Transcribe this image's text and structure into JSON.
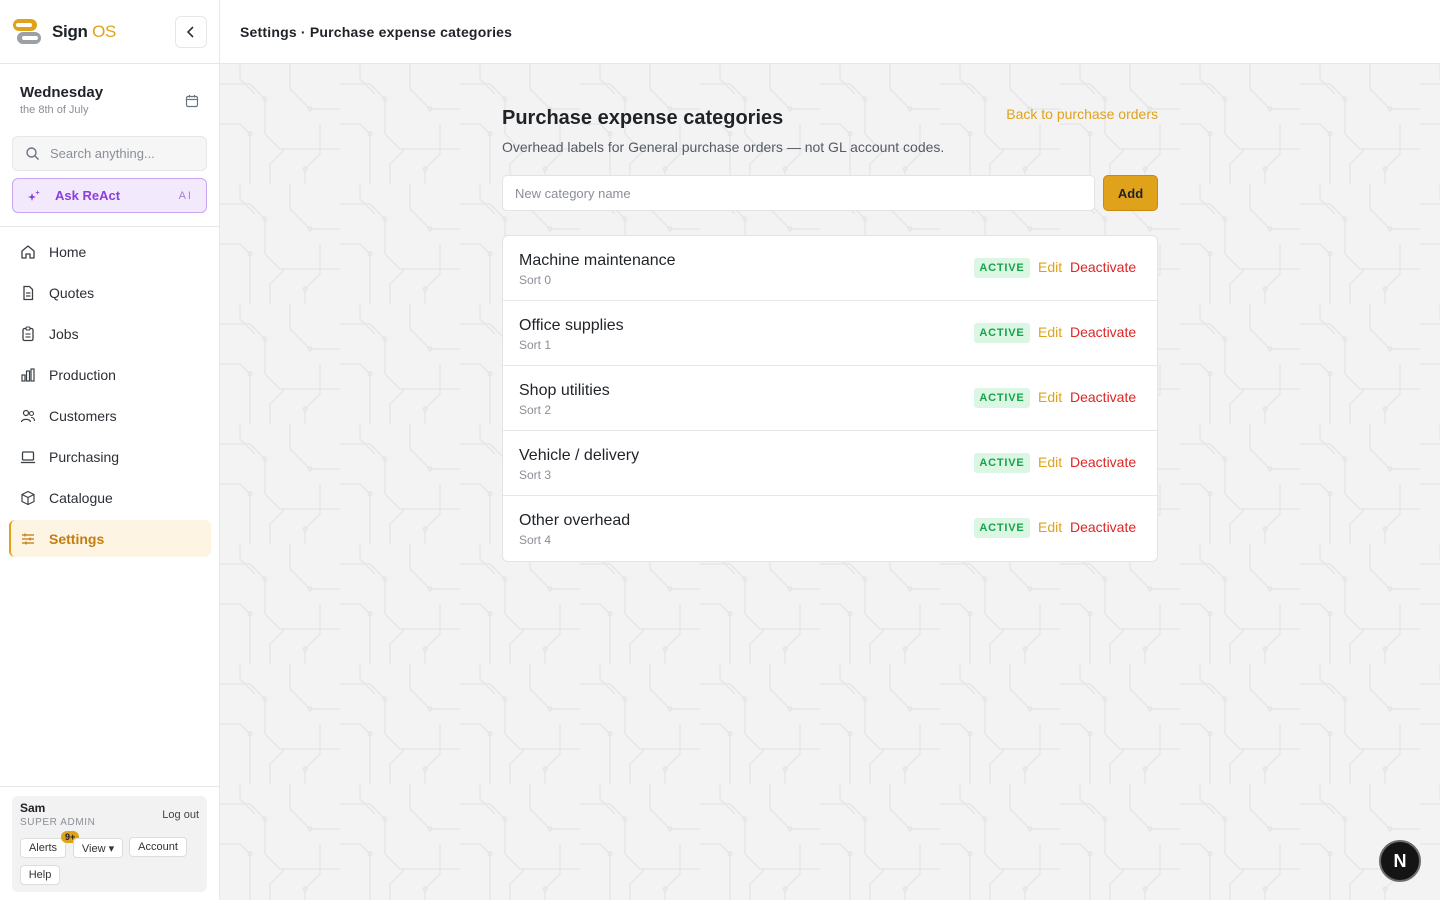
{
  "brand": {
    "name": "Sign ",
    "suffix": "OS"
  },
  "date": {
    "day": "Wednesday",
    "sub": "the 8th of July"
  },
  "search": {
    "placeholder": "Search anything..."
  },
  "ask": {
    "label": "Ask ReAct",
    "tag": "AI"
  },
  "nav": {
    "items": [
      {
        "label": "Home",
        "icon": "home-icon"
      },
      {
        "label": "Quotes",
        "icon": "document-icon"
      },
      {
        "label": "Jobs",
        "icon": "clipboard-icon"
      },
      {
        "label": "Production",
        "icon": "bar-chart-icon"
      },
      {
        "label": "Customers",
        "icon": "users-icon"
      },
      {
        "label": "Purchasing",
        "icon": "laptop-icon"
      },
      {
        "label": "Catalogue",
        "icon": "box-icon"
      },
      {
        "label": "Settings",
        "icon": "sliders-icon",
        "active": true
      }
    ]
  },
  "user": {
    "name": "Sam",
    "role": "SUPER ADMIN",
    "logout": "Log out",
    "alerts": "Alerts",
    "alerts_badge": "9+",
    "view": "View ▾",
    "account": "Account",
    "help": "Help"
  },
  "topbar": {
    "breadcrumb": "Settings · Purchase expense categories"
  },
  "page": {
    "title": "Purchase expense categories",
    "subtitle": "Overhead labels for General purchase orders — not GL account codes.",
    "back_link": "Back to purchase orders",
    "new_placeholder": "New category name",
    "add_label": "Add"
  },
  "categories": [
    {
      "name": "Machine maintenance",
      "sort": "Sort 0",
      "status": "ACTIVE",
      "edit": "Edit",
      "action": "Deactivate"
    },
    {
      "name": "Office supplies",
      "sort": "Sort 1",
      "status": "ACTIVE",
      "edit": "Edit",
      "action": "Deactivate"
    },
    {
      "name": "Shop utilities",
      "sort": "Sort 2",
      "status": "ACTIVE",
      "edit": "Edit",
      "action": "Deactivate"
    },
    {
      "name": "Vehicle / delivery",
      "sort": "Sort 3",
      "status": "ACTIVE",
      "edit": "Edit",
      "action": "Deactivate"
    },
    {
      "name": "Other overhead",
      "sort": "Sort 4",
      "status": "ACTIVE",
      "edit": "Edit",
      "action": "Deactivate"
    }
  ],
  "fab": {
    "label": "N"
  },
  "colors": {
    "accent": "#e0a21b",
    "danger": "#dc2626",
    "success": "#16a34a",
    "ai": "#8b3fd9"
  }
}
